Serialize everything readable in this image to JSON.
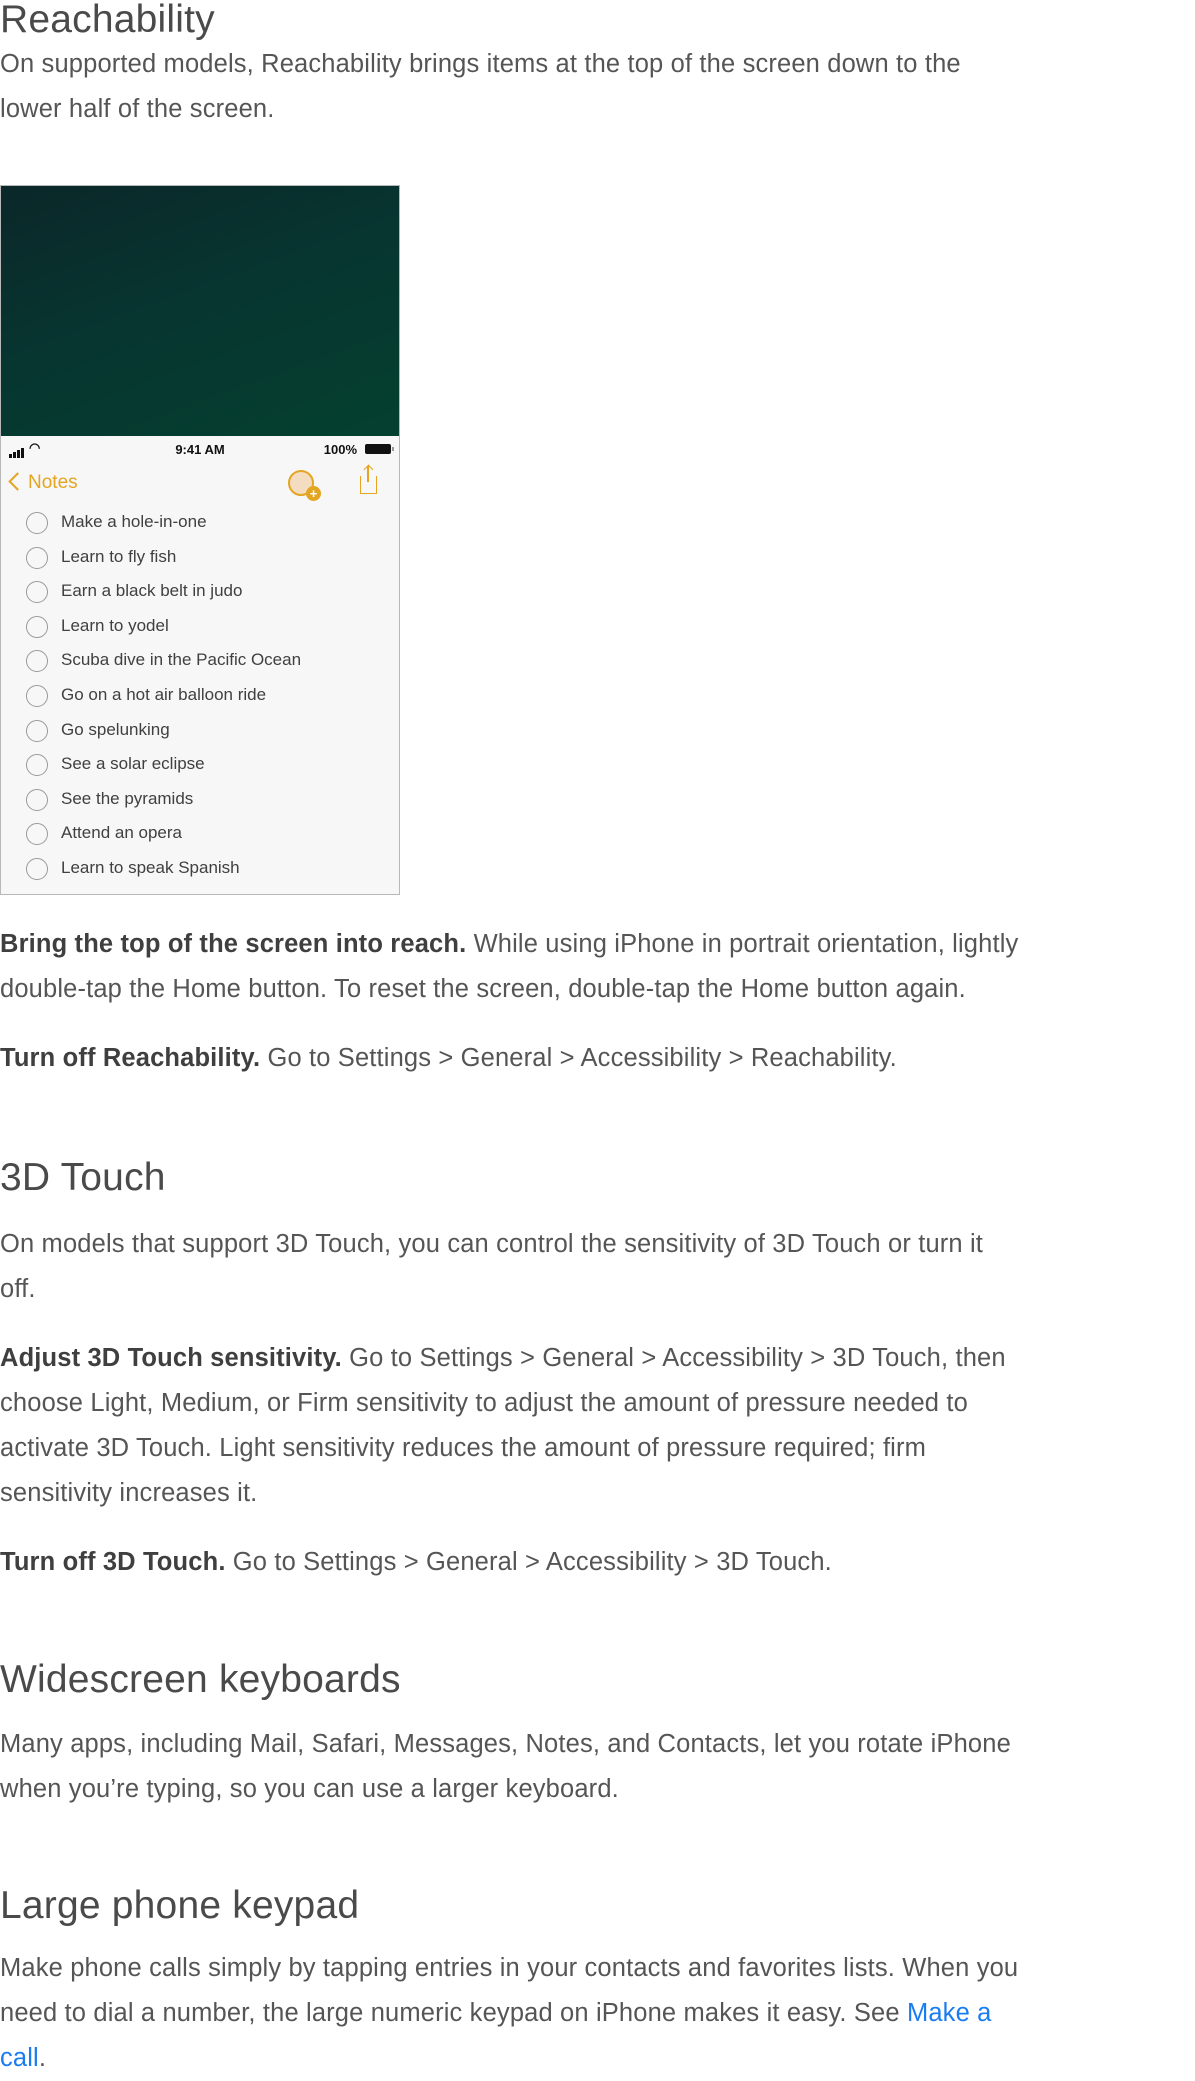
{
  "sections": {
    "reachability": {
      "title": "Reachability",
      "intro_line1": "On supported models, Reachability brings items at the top of the screen down to the",
      "intro_line2": "lower half of the screen.",
      "tip1": {
        "bold": "Bring the top of the screen into reach.",
        "text_line1": " While using iPhone in portrait orientation, lightly",
        "text_line2": "double-tap the Home button. To reset the screen, double-tap the Home button again."
      },
      "tip2": {
        "bold": "Turn off Reachability.",
        "text": " Go to Settings > General > Accessibility > Reachability."
      }
    },
    "touch3d": {
      "title": "3D Touch",
      "intro_line1": "On models that support 3D Touch, you can control the sensitivity of 3D Touch or turn it",
      "intro_line2": "off.",
      "tip1": {
        "bold": "Adjust 3D Touch sensitivity.",
        "text_line1": " Go to Settings > General > Accessibility > 3D Touch, then",
        "text_line2": "choose Light, Medium, or Firm sensitivity to adjust the amount of pressure needed to",
        "text_line3": "activate 3D Touch. Light sensitivity reduces the amount of pressure required; firm",
        "text_line4": "sensitivity increases it."
      },
      "tip2": {
        "bold": "Turn off 3D Touch.",
        "text": " Go to Settings > General > Accessibility > 3D Touch."
      }
    },
    "widescreen": {
      "title": "Widescreen keyboards",
      "line1": "Many apps, including Mail, Safari, Messages, Notes, and Contacts, let you rotate iPhone",
      "line2": "when you’re typing, so you can use a larger keyboard."
    },
    "keypad": {
      "title": "Large phone keypad",
      "line1": "Make phone calls simply by tapping entries in your contacts and favorites lists. When you",
      "line2_text": "need to dial a number, the large numeric keypad on iPhone makes it easy. See ",
      "link_part1": "Make a",
      "link_part2": "call",
      "after_link": "."
    }
  },
  "phone": {
    "status_time": "9:41 AM",
    "battery": "100%",
    "back_label": "Notes",
    "wifi_icon": "◔",
    "add_icon": "+",
    "items": [
      "Make a hole-in-one",
      "Learn to fly fish",
      "Earn a black belt in judo",
      "Learn to yodel",
      "Scuba dive in the Pacific Ocean",
      "Go on a hot air balloon ride",
      "Go spelunking",
      "See a solar eclipse",
      "See the pyramids",
      "Attend an opera",
      "Learn to speak Spanish"
    ]
  },
  "colors": {
    "accent": "#e3a522",
    "link": "#1a7cf0",
    "wallpaper": "#06382f"
  }
}
